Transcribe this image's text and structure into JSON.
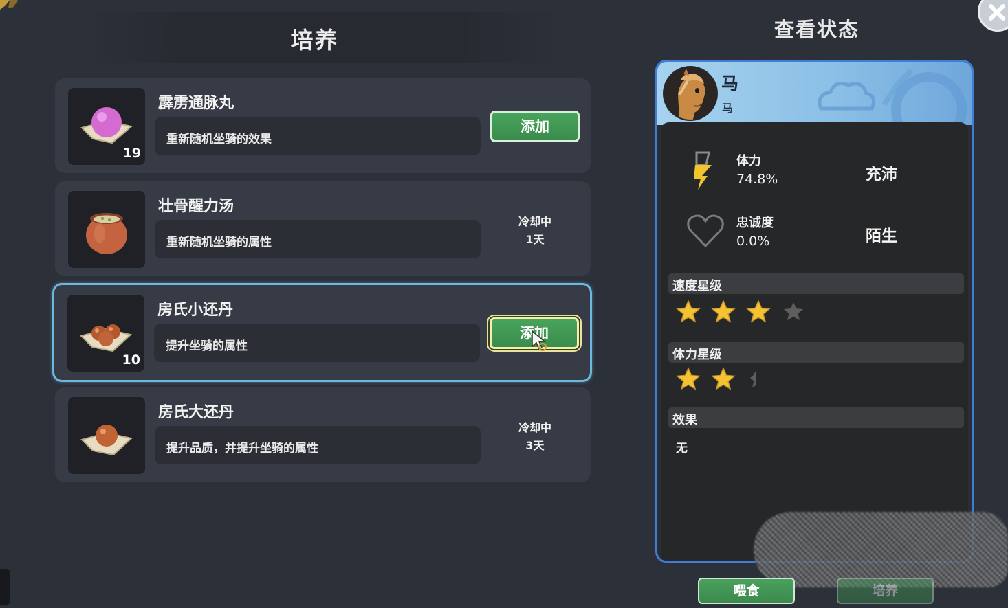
{
  "left_panel": {
    "title": "培养",
    "items": [
      {
        "name": "霹雳通脉丸",
        "desc": "重新随机坐骑的效果",
        "count": "19",
        "action": "添加",
        "cooldown_label": "",
        "cooldown_time": ""
      },
      {
        "name": "壮骨醒力汤",
        "desc": "重新随机坐骑的属性",
        "count": "",
        "action": "",
        "cooldown_label": "冷却中",
        "cooldown_time": "1天"
      },
      {
        "name": "房氏小还丹",
        "desc": "提升坐骑的属性",
        "count": "10",
        "action": "添加",
        "cooldown_label": "",
        "cooldown_time": "",
        "selected": true
      },
      {
        "name": "房氏大还丹",
        "desc": "提升品质，并提升坐骑的属性",
        "count": "",
        "action": "",
        "cooldown_label": "冷却中",
        "cooldown_time": "3天"
      }
    ]
  },
  "status": {
    "title": "查看状态",
    "mount_name": "马",
    "mount_type": "马",
    "stamina": {
      "label": "体力",
      "value": "74.8%",
      "state": "充沛"
    },
    "loyalty": {
      "label": "忠诚度",
      "value": "0.0%",
      "state": "陌生"
    },
    "speed_stars": {
      "label": "速度星级",
      "rating": 3,
      "max": 4
    },
    "stamina_stars": {
      "label": "体力星级",
      "rating": 2.5,
      "max": 3
    },
    "effect": {
      "label": "效果",
      "value": "无"
    }
  },
  "bottom_buttons": {
    "feed": "喂食",
    "train": "培养"
  },
  "colors": {
    "accent_green": "#48a45c",
    "selected_border": "#6eb7e0",
    "panel_border": "#3f7ed4",
    "star_gold": "#f5c331"
  },
  "icons": [
    "close-icon",
    "pill-icon",
    "soup-pot-icon",
    "small-pills-icon",
    "big-pill-icon",
    "horse-avatar",
    "lightning-icon",
    "heart-icon",
    "star-icon",
    "cursor-icon"
  ]
}
